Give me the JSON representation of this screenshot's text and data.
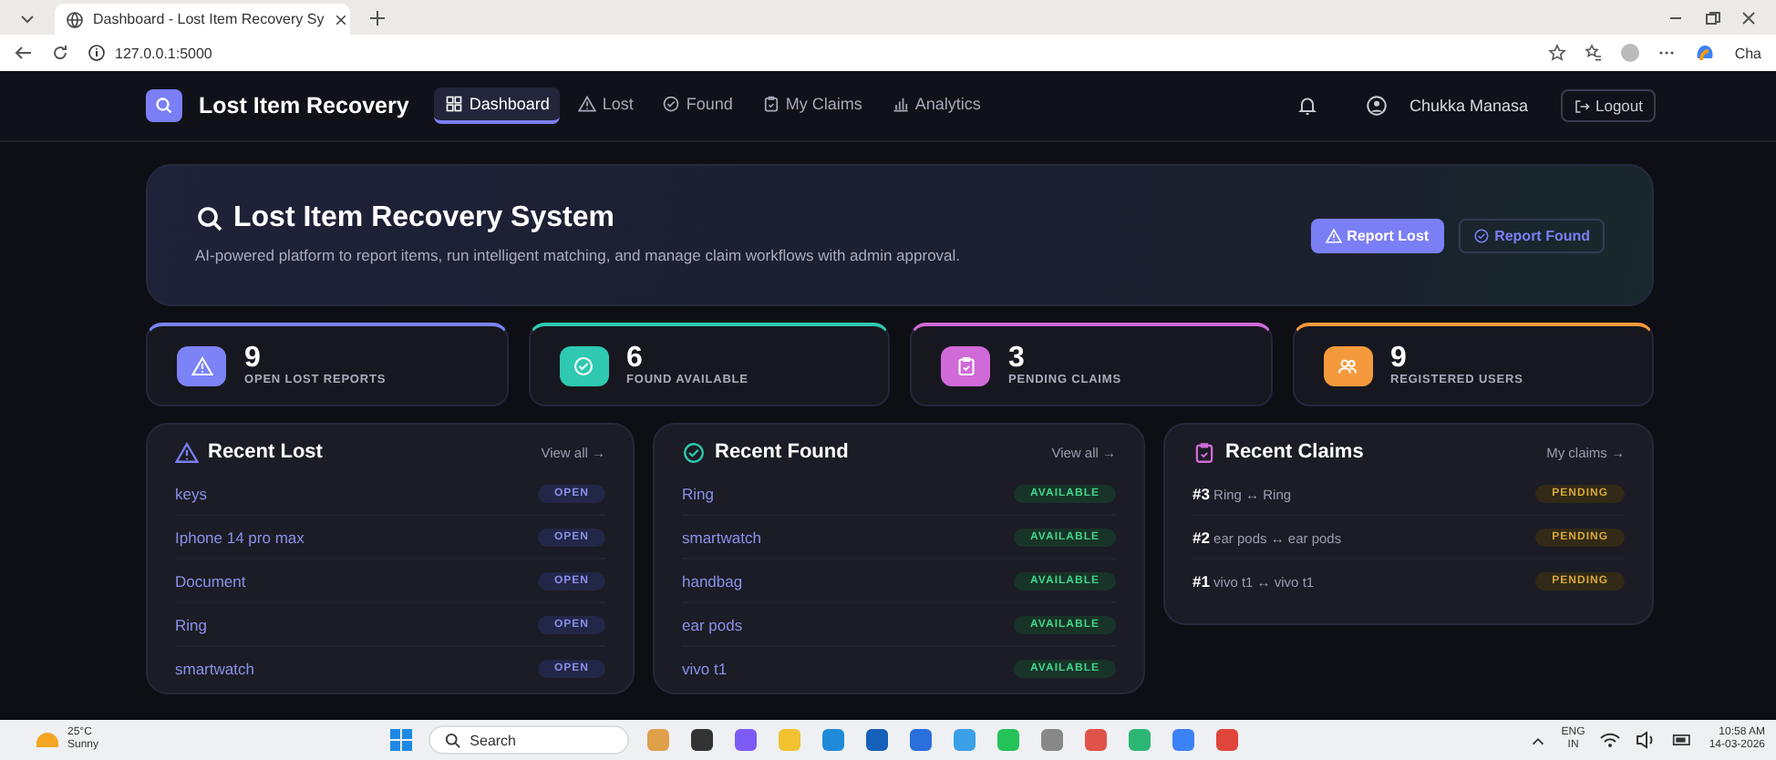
{
  "browser": {
    "tab_title": "Dashboard - Lost Item Recovery Sy",
    "url": "127.0.0.1:5000",
    "profile_label": "Cha"
  },
  "nav": {
    "brand": "Lost Item Recovery",
    "links": [
      {
        "label": "Dashboard",
        "kind": "grid",
        "selected": true
      },
      {
        "label": "Lost",
        "kind": "warning",
        "selected": false
      },
      {
        "label": "Found",
        "kind": "check",
        "selected": false
      },
      {
        "label": "My Claims",
        "kind": "clipboard",
        "selected": false
      },
      {
        "label": "Analytics",
        "kind": "chart",
        "selected": false
      }
    ],
    "user": "Chukka Manasa",
    "logout": "Logout"
  },
  "hero": {
    "title": "Lost Item Recovery System",
    "subtitle": "AI-powered platform to report items, run intelligent matching, and manage claim workflows with admin approval.",
    "buttons": [
      {
        "label": "Report Lost",
        "kind": "primary"
      },
      {
        "label": "Report Found",
        "kind": "outline"
      }
    ]
  },
  "stats": [
    {
      "value": "9",
      "label": "OPEN LOST REPORTS",
      "kind": "warning",
      "color": "#7c83f7"
    },
    {
      "value": "6",
      "label": "FOUND AVAILABLE",
      "kind": "check",
      "color": "#2ec9b0"
    },
    {
      "value": "3",
      "label": "PENDING CLAIMS",
      "kind": "clipboard",
      "color": "#d06ad8"
    },
    {
      "value": "9",
      "label": "REGISTERED USERS",
      "kind": "users",
      "color": "#f59a3c"
    }
  ],
  "panels": [
    {
      "kind": "warning",
      "title": "Recent Lost",
      "link": "View all →",
      "rows": [
        {
          "name": "keys",
          "status": "OPEN"
        },
        {
          "name": "Iphone 14 pro max",
          "status": "OPEN"
        },
        {
          "name": "Document",
          "status": "OPEN"
        },
        {
          "name": "Ring",
          "status": "OPEN"
        },
        {
          "name": "smartwatch",
          "status": "OPEN"
        }
      ]
    },
    {
      "kind": "check",
      "title": "Recent Found",
      "link": "View all →",
      "rows": [
        {
          "name": "Ring",
          "status": "AVAILABLE"
        },
        {
          "name": "smartwatch",
          "status": "AVAILABLE"
        },
        {
          "name": "handbag",
          "status": "AVAILABLE"
        },
        {
          "name": "ear pods",
          "status": "AVAILABLE"
        },
        {
          "name": "vivo t1",
          "status": "AVAILABLE"
        }
      ]
    },
    {
      "kind": "clipboard",
      "title": "Recent Claims",
      "link": "My claims →",
      "rows": [
        {
          "number": "#3",
          "name": "Ring ↔ Ring",
          "status": "PENDING"
        },
        {
          "number": "#2",
          "name": "ear pods ↔ ear pods",
          "status": "PENDING"
        },
        {
          "number": "#1",
          "name": "vivo t1 ↔ vivo t1",
          "status": "PENDING"
        }
      ]
    }
  ],
  "taskbar": {
    "temperature": "25°C",
    "weather": "Sunny",
    "search": "Search",
    "language": "ENG",
    "region": "IN",
    "time": "10:58 AM",
    "date": "14-03-2026"
  }
}
